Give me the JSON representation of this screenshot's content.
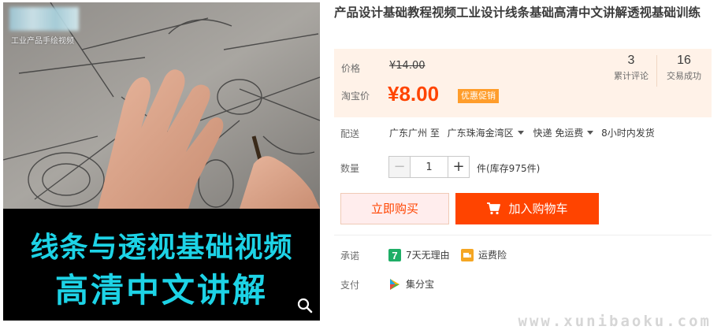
{
  "gallery": {
    "logo_caption": "工业产品手绘视频",
    "banner_line1": "线条与透视基础视频",
    "banner_line2": "高清中文讲解",
    "zoom_icon": "search-icon"
  },
  "product": {
    "title": "产品设计基础教程视频工业设计线条基础高清中文讲解透视基础训练"
  },
  "price": {
    "original_label": "价格",
    "original_value": "¥14.00",
    "sale_label": "淘宝价",
    "sale_value": "¥8.00",
    "promo_tag": "优惠促销"
  },
  "stats": [
    {
      "value": "3",
      "label": "累计评论"
    },
    {
      "value": "16",
      "label": "交易成功"
    }
  ],
  "delivery": {
    "label": "配送",
    "from": "广东广州 至",
    "to": "广东珠海金湾区",
    "method": "快递 免运费",
    "ship_time": "8小时内发货"
  },
  "quantity": {
    "label": "数量",
    "value": "1",
    "minus": "−",
    "plus": "+",
    "stock_text": "件(库存975件)"
  },
  "actions": {
    "buy_now": "立即购买",
    "add_to_cart": "加入购物车",
    "cart_icon": "cart-icon"
  },
  "promise": {
    "label": "承诺",
    "items": [
      {
        "icon": "seven-day-return-icon",
        "text": "7天无理由",
        "badge": "7",
        "color": "#1fae67"
      },
      {
        "icon": "freight-insurance-icon",
        "text": "运费险",
        "color": "#f5a623"
      }
    ]
  },
  "payment": {
    "label": "支付",
    "items": [
      {
        "icon": "jifenbao-icon",
        "text": "集分宝"
      }
    ]
  },
  "watermark": "www.xunibaoku.com",
  "colors": {
    "accent": "#ff4400",
    "price_bg": "#fff2e8",
    "banner_text": "#1dd3e6",
    "promo": "#ff9d2b"
  }
}
